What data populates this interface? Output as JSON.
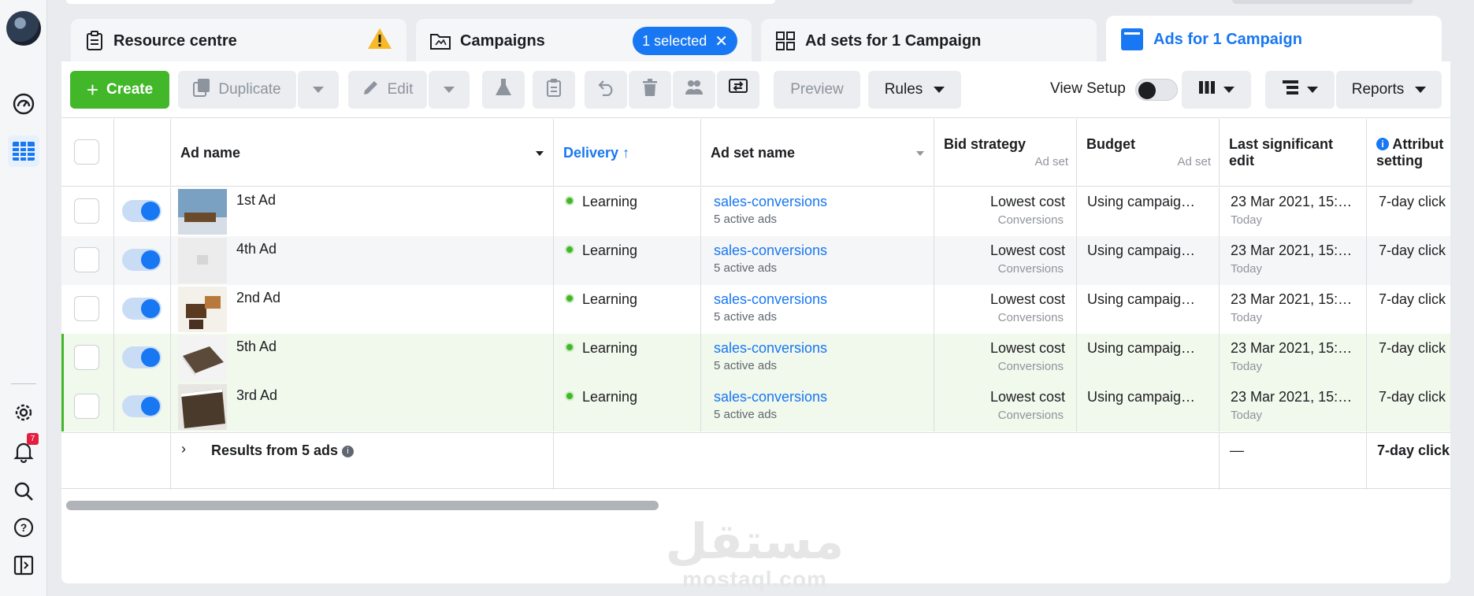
{
  "sidebar": {
    "notification_count": "7",
    "items": [
      {
        "icon": "gauge-icon"
      },
      {
        "icon": "table-grid-icon",
        "active": true
      },
      {
        "icon": "gear-icon"
      },
      {
        "icon": "bell-icon"
      },
      {
        "icon": "search-icon"
      },
      {
        "icon": "help-icon"
      },
      {
        "icon": "panel-toggle-icon"
      }
    ]
  },
  "tabs": {
    "resource": "Resource centre",
    "campaigns": "Campaigns",
    "selected_pill": "1 selected",
    "adsets": "Ad sets for 1 Campaign",
    "ads": "Ads for 1 Campaign"
  },
  "toolbar": {
    "create": "Create",
    "duplicate": "Duplicate",
    "edit": "Edit",
    "preview": "Preview",
    "rules": "Rules",
    "view_setup": "View Setup",
    "reports": "Reports"
  },
  "columns": {
    "ad_name": "Ad name",
    "delivery": "Delivery",
    "adset_name": "Ad set name",
    "bid_strategy": "Bid strategy",
    "bid_sub": "Ad set",
    "budget": "Budget",
    "budget_sub": "Ad set",
    "last_edit_1": "Last significant",
    "last_edit_2": "edit",
    "attribution_1": "Attribut",
    "attribution_2": "setting"
  },
  "rows": [
    {
      "name": "1st Ad",
      "delivery": "Learning",
      "adset": "sales-conversions",
      "adset_sub": "5 active ads",
      "bid": "Lowest cost",
      "bid_sub": "Conversions",
      "budget": "Using campaig…",
      "edit": "23 Mar 2021, 15:…",
      "edit_sub": "Today",
      "attribution": "7-day click"
    },
    {
      "name": "4th Ad",
      "delivery": "Learning",
      "adset": "sales-conversions",
      "adset_sub": "5 active ads",
      "bid": "Lowest cost",
      "bid_sub": "Conversions",
      "budget": "Using campaig…",
      "edit": "23 Mar 2021, 15:…",
      "edit_sub": "Today",
      "attribution": "7-day click"
    },
    {
      "name": "2nd Ad",
      "delivery": "Learning",
      "adset": "sales-conversions",
      "adset_sub": "5 active ads",
      "bid": "Lowest cost",
      "bid_sub": "Conversions",
      "budget": "Using campaig…",
      "edit": "23 Mar 2021, 15:…",
      "edit_sub": "Today",
      "attribution": "7-day click"
    },
    {
      "name": "5th Ad",
      "delivery": "Learning",
      "adset": "sales-conversions",
      "adset_sub": "5 active ads",
      "bid": "Lowest cost",
      "bid_sub": "Conversions",
      "budget": "Using campaig…",
      "edit": "23 Mar 2021, 15:…",
      "edit_sub": "Today",
      "attribution": "7-day click"
    },
    {
      "name": "3rd Ad",
      "delivery": "Learning",
      "adset": "sales-conversions",
      "adset_sub": "5 active ads",
      "bid": "Lowest cost",
      "bid_sub": "Conversions",
      "budget": "Using campaig…",
      "edit": "23 Mar 2021, 15:…",
      "edit_sub": "Today",
      "attribution": "7-day click"
    }
  ],
  "summary": {
    "label": "Results from 5 ads",
    "last_edit": "—",
    "attribution": "7-day click"
  },
  "watermark": {
    "arabic": "مستقل",
    "latin": "mostaql.com"
  },
  "colors": {
    "accent": "#1877f2",
    "create": "#42b72a",
    "learning_dot": "#42b72a",
    "warning": "#f7b928",
    "selected_row": "#f1f8ec"
  }
}
